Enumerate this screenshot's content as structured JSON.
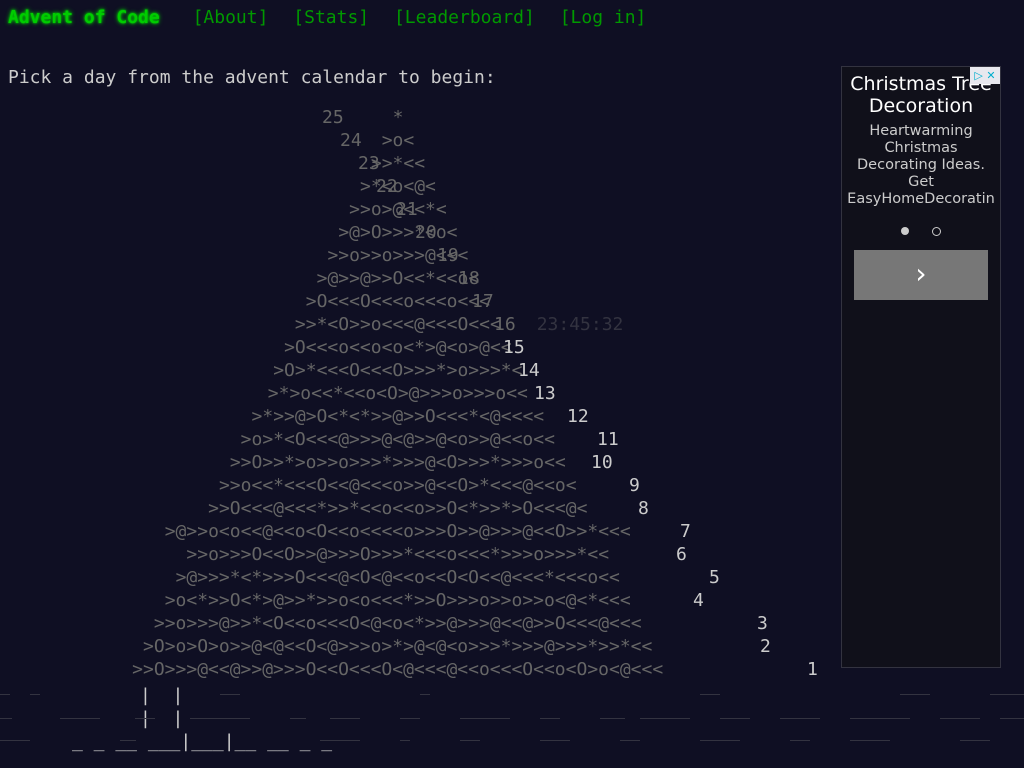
{
  "header": {
    "title": "Advent of Code",
    "nav": [
      "[About]",
      "[Stats]",
      "[Leaderboard]",
      "[Log in]"
    ]
  },
  "intro": "Pick a day from the advent calendar to begin:",
  "calendar": {
    "countdown": "23:45:32",
    "rows": [
      {
        "art": "*",
        "day": "25",
        "state": "hidden"
      },
      {
        "art": ">o<",
        "day": "24",
        "state": "hidden"
      },
      {
        "art": ">>*<<",
        "day": "23",
        "state": "hidden"
      },
      {
        "art": ">*<o<@<",
        "day": "22",
        "state": "hidden"
      },
      {
        "art": ">>o>@<<*<",
        "day": "21",
        "state": "hidden"
      },
      {
        "art": ">@>O>>>*<o<",
        "day": "20",
        "state": "hidden"
      },
      {
        "art": ">>o>>o>>>@<<<",
        "day": "19",
        "state": "hidden"
      },
      {
        "art": ">@>>@>>O<<*<<o<",
        "day": "18",
        "state": "hidden"
      },
      {
        "art": ">O<<<O<<<o<<<o<<<",
        "day": "17",
        "state": "hidden"
      },
      {
        "art": ">>*<O>>o<<<@<<<O<<<",
        "day": "16",
        "state": "hidden"
      },
      {
        "art": ">O<<<o<<o<o<*>@<o>@<<",
        "day": "15",
        "state": "avail"
      },
      {
        "art": ">O>*<<<O<<<O>>>*>o>>>*<",
        "day": "14",
        "state": "avail"
      },
      {
        "art": ">*>o<<*<<o<O>@>>>o>>>o<<",
        "day": "13",
        "state": "avail"
      },
      {
        "art": ">*>>@>O<*<*>>@>>O<<<*<@<<<<",
        "day": "12",
        "state": "avail"
      },
      {
        "art": ">o>*<O<<<@>>>@<@>>@<o>>@<<o<<",
        "day": "11",
        "state": "avail"
      },
      {
        "art": ">>O>>*>o>>o>>>*>>>@<O>>>*>>>o<<",
        "day": "10",
        "state": "avail"
      },
      {
        "art": ">>o<<*<<<O<<@<<<o>>@<<O>*<<<@<<o<",
        "day": "9",
        "state": "avail"
      },
      {
        "art": ">>O<<<@<<<*>>*<<o<<o>>O<*>>*>O<<<@<",
        "day": "8",
        "state": "avail"
      },
      {
        "art": ">@>>o<o<<@<<o<O<<o<<<<o>>>O>>@>>>@<<O>>*<<<",
        "day": "7",
        "state": "avail"
      },
      {
        "art": ">>o>>>O<<O>>@>>>O>>>*<<<o<<<*>>>o>>>*<<",
        "day": "6",
        "state": "avail"
      },
      {
        "art": ">@>>>*<*>>>O<<<@<O<@<<o<<O<O<<@<<<*<<<o<<",
        "day": "5",
        "state": "avail"
      },
      {
        "art": ">o<*>>O<*>@>>*>>o<o<<<*>>O>>>o>>o>>o<@<*<<<",
        "day": "4",
        "state": "avail"
      },
      {
        "art": ">>o>>>@>>*<O<<o<<<O<@<o<*>>@>>>@<<@>>O<<<@<<<",
        "day": "3",
        "state": "avail"
      },
      {
        "art": ">O>o>O>o>>@<@<<O<@>>>o>*>@<@<o>>>*>>>@>>>*>>*<<",
        "day": "2",
        "state": "avail"
      },
      {
        "art": ">>O>>>@<<@>>@>>>O<<O<<<O<@<<<@<<o<<<O<<o<O>o<@<<<",
        "day": "1",
        "state": "avail"
      }
    ],
    "trunk": [
      "|  |",
      "|  |",
      "_ _ __ ___|___|__ __ _ _"
    ]
  },
  "sponsor": {
    "close": "▷ ✕",
    "title": "Christmas Tree Decoration",
    "text": "Heartwarming Christmas Decorating Ideas. Get EasyHomeDecoratin",
    "next": "›"
  },
  "colors": {
    "background": "#0f0f23",
    "title_green": "#00cc00",
    "link_green": "#009900",
    "text": "#cccccc",
    "dim": "#666666"
  }
}
